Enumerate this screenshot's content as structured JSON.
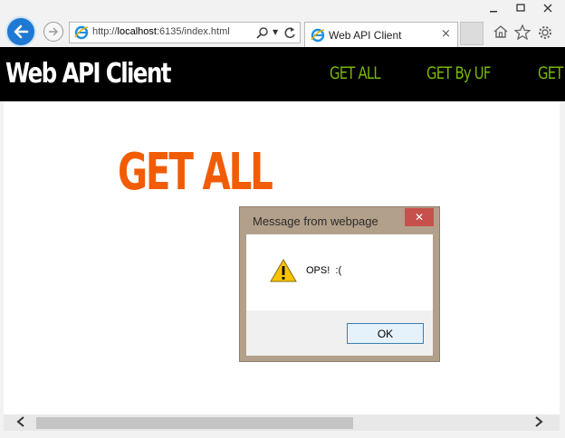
{
  "browser": {
    "address": {
      "protocol": "http://",
      "host": "localhost",
      "rest": ":6135/index.html"
    },
    "tab_title": "Web API Client",
    "tab_close": "×",
    "window_controls": {
      "minimize": "minimize-icon",
      "maximize": "maximize-icon",
      "close": "close-icon"
    }
  },
  "site": {
    "title": "Web API Client",
    "nav": [
      "GET ALL",
      "GET By UF",
      "GET"
    ],
    "heading": "GET ALL"
  },
  "dialog": {
    "title": "Message from webpage",
    "message": "OPS!  :(",
    "ok_label": "OK",
    "close_glyph": "✕"
  },
  "colors": {
    "nav_background": "#000000",
    "nav_link": "#7ab800",
    "heading": "#f25c05",
    "dialog_frame": "#b3a08a",
    "dialog_close": "#c7504c",
    "back_button": "#1e79d2"
  }
}
